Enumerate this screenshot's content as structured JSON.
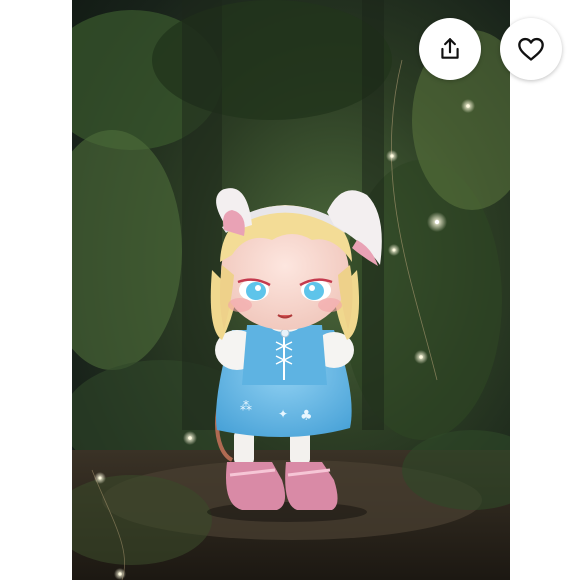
{
  "toolbar": {
    "share_icon": "share-icon",
    "favorite_icon": "heart-icon"
  },
  "photo": {
    "subject": "product-photo"
  },
  "colors": {
    "button_bg": "#ffffff",
    "icon_stroke": "#111111",
    "page_bg": "#ffffff"
  }
}
